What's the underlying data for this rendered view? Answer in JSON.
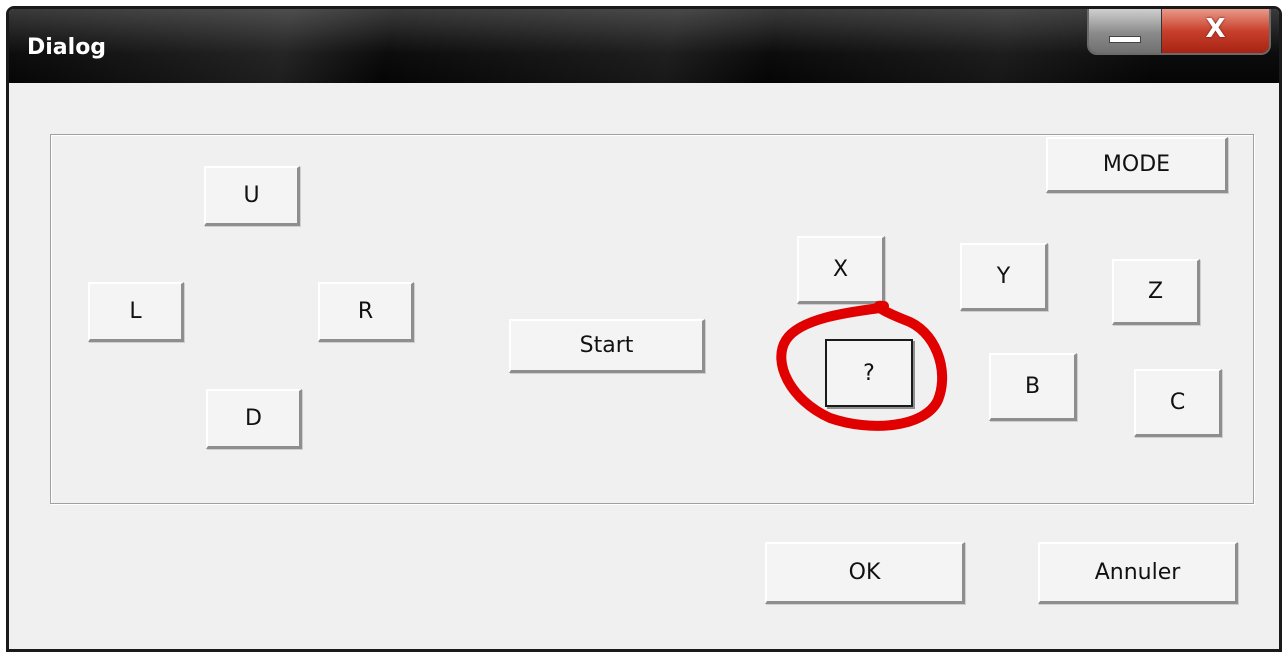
{
  "window": {
    "title": "Dialog",
    "minimize_icon": "minimize-icon",
    "close_label": "X"
  },
  "dpad": {
    "up": "U",
    "left": "L",
    "right": "R",
    "down": "D"
  },
  "center": {
    "start": "Start"
  },
  "face": {
    "mode": "MODE",
    "x": "X",
    "y": "Y",
    "z": "Z",
    "unknown": "?",
    "b": "B",
    "c": "C"
  },
  "footer": {
    "ok": "OK",
    "cancel": "Annuler"
  },
  "colors": {
    "annotation": "#e00000"
  }
}
